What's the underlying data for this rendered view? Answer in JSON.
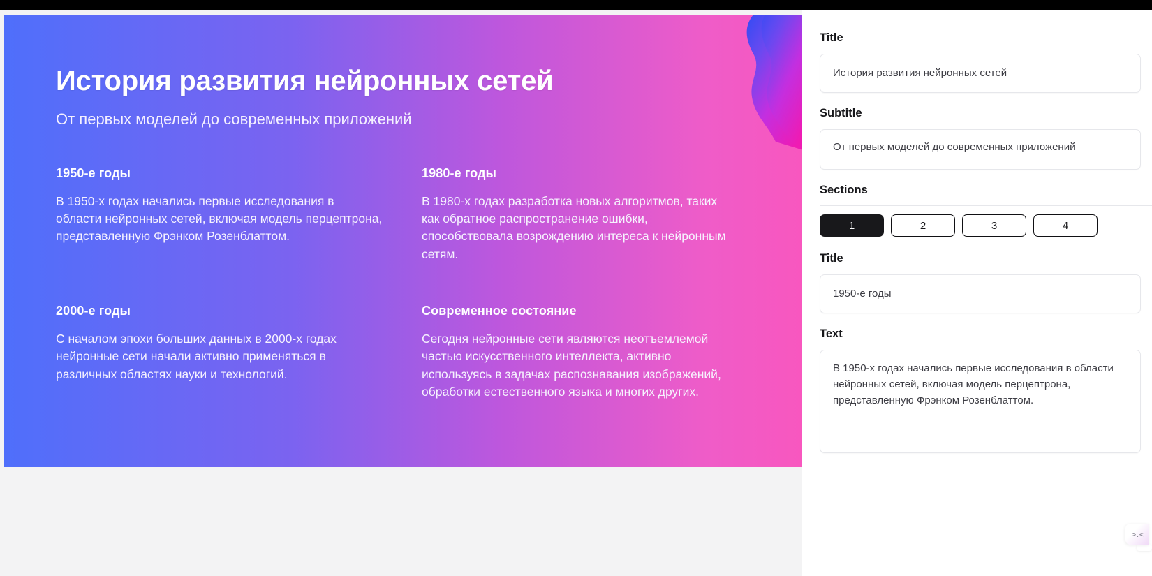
{
  "slide": {
    "title": "История развития нейронных сетей",
    "subtitle": "От первых моделей до современных приложений",
    "sections": [
      {
        "title": "1950-е годы",
        "text": "В 1950-х годах начались первые исследования в области нейронных сетей, включая модель перцептрона, представленную Фрэнком Розенблаттом."
      },
      {
        "title": "1980-е годы",
        "text": "В 1980-х годах разработка новых алгоритмов, таких как обратное распространение ошибки, способствовала возрождению интереса к нейронным сетям."
      },
      {
        "title": "2000-е годы",
        "text": "С началом эпохи больших данных в 2000-х годах нейронные сети начали активно применяться в различных областях науки и технологий."
      },
      {
        "title": "Современное состояние",
        "text": "Сегодня нейронные сети являются неотъемлемой частью искусственного интеллекта, активно используясь в задачах распознавания изображений, обработки естественного языка и многих других."
      }
    ]
  },
  "sidebar": {
    "title_label": "Title",
    "title_value": "История развития нейронных сетей",
    "subtitle_label": "Subtitle",
    "subtitle_value": "От первых моделей до современных приложений",
    "sections_label": "Sections",
    "section_tabs": [
      "1",
      "2",
      "3",
      "4"
    ],
    "active_tab": "1",
    "section_title_label": "Title",
    "section_title_value": "1950-е годы",
    "section_text_label": "Text",
    "section_text_value": "В 1950-х годах начались первые исследования в области нейронных сетей, включая модель перцептрона, представленную Фрэнком Розенблаттом."
  },
  "widget": {
    "face": ">.<"
  },
  "colors": {
    "gradient_start": "#4f6ffb",
    "gradient_end": "#f857bf",
    "active_tab_bg": "#18181b",
    "stage_bg": "#f3f3f4"
  }
}
